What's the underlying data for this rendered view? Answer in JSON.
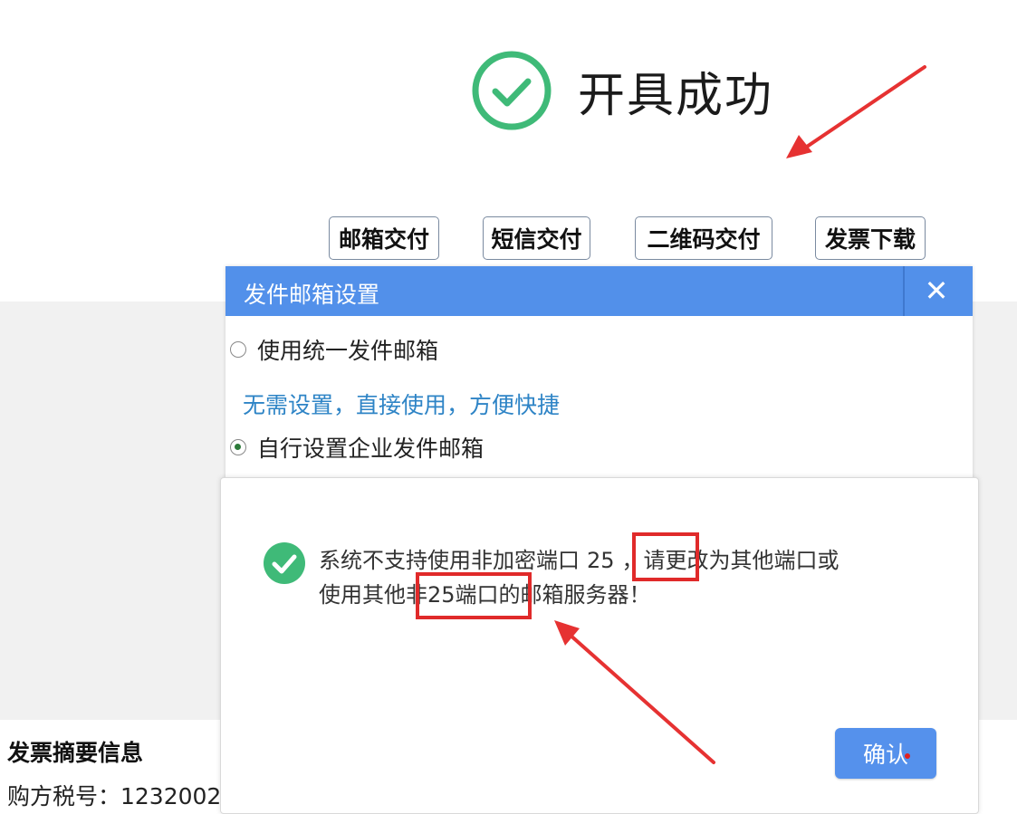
{
  "success": {
    "title": "开具成功",
    "icon": "check-circle-icon",
    "color": "#3fba78"
  },
  "delivery_buttons": [
    {
      "label": "邮箱交付"
    },
    {
      "label": "短信交付"
    },
    {
      "label": "二维码交付"
    },
    {
      "label": "发票下载"
    }
  ],
  "mail_dialog": {
    "title": "发件邮箱设置",
    "close_label": "✕",
    "option_unified": "使用统一发件邮箱",
    "hint": "无需设置，直接使用，方便快捷",
    "option_custom": "自行设置企业发件邮箱",
    "selected": "option_custom",
    "header_color": "#5290ea"
  },
  "alert": {
    "icon": "check-circle-icon",
    "line1_prefix": "系统不支持使用非加密端口",
    "port": "25",
    "line1_suffix": "，请更改为其他端口或",
    "line2": "使用其他非25端口的邮箱服务器！",
    "confirm_label": "确认",
    "button_color": "#5591ec"
  },
  "summary": {
    "title": "发票摘要信息",
    "tax_label": "购方税号：1232002"
  },
  "annotations": {
    "highlight_color": "#e02a2a"
  }
}
